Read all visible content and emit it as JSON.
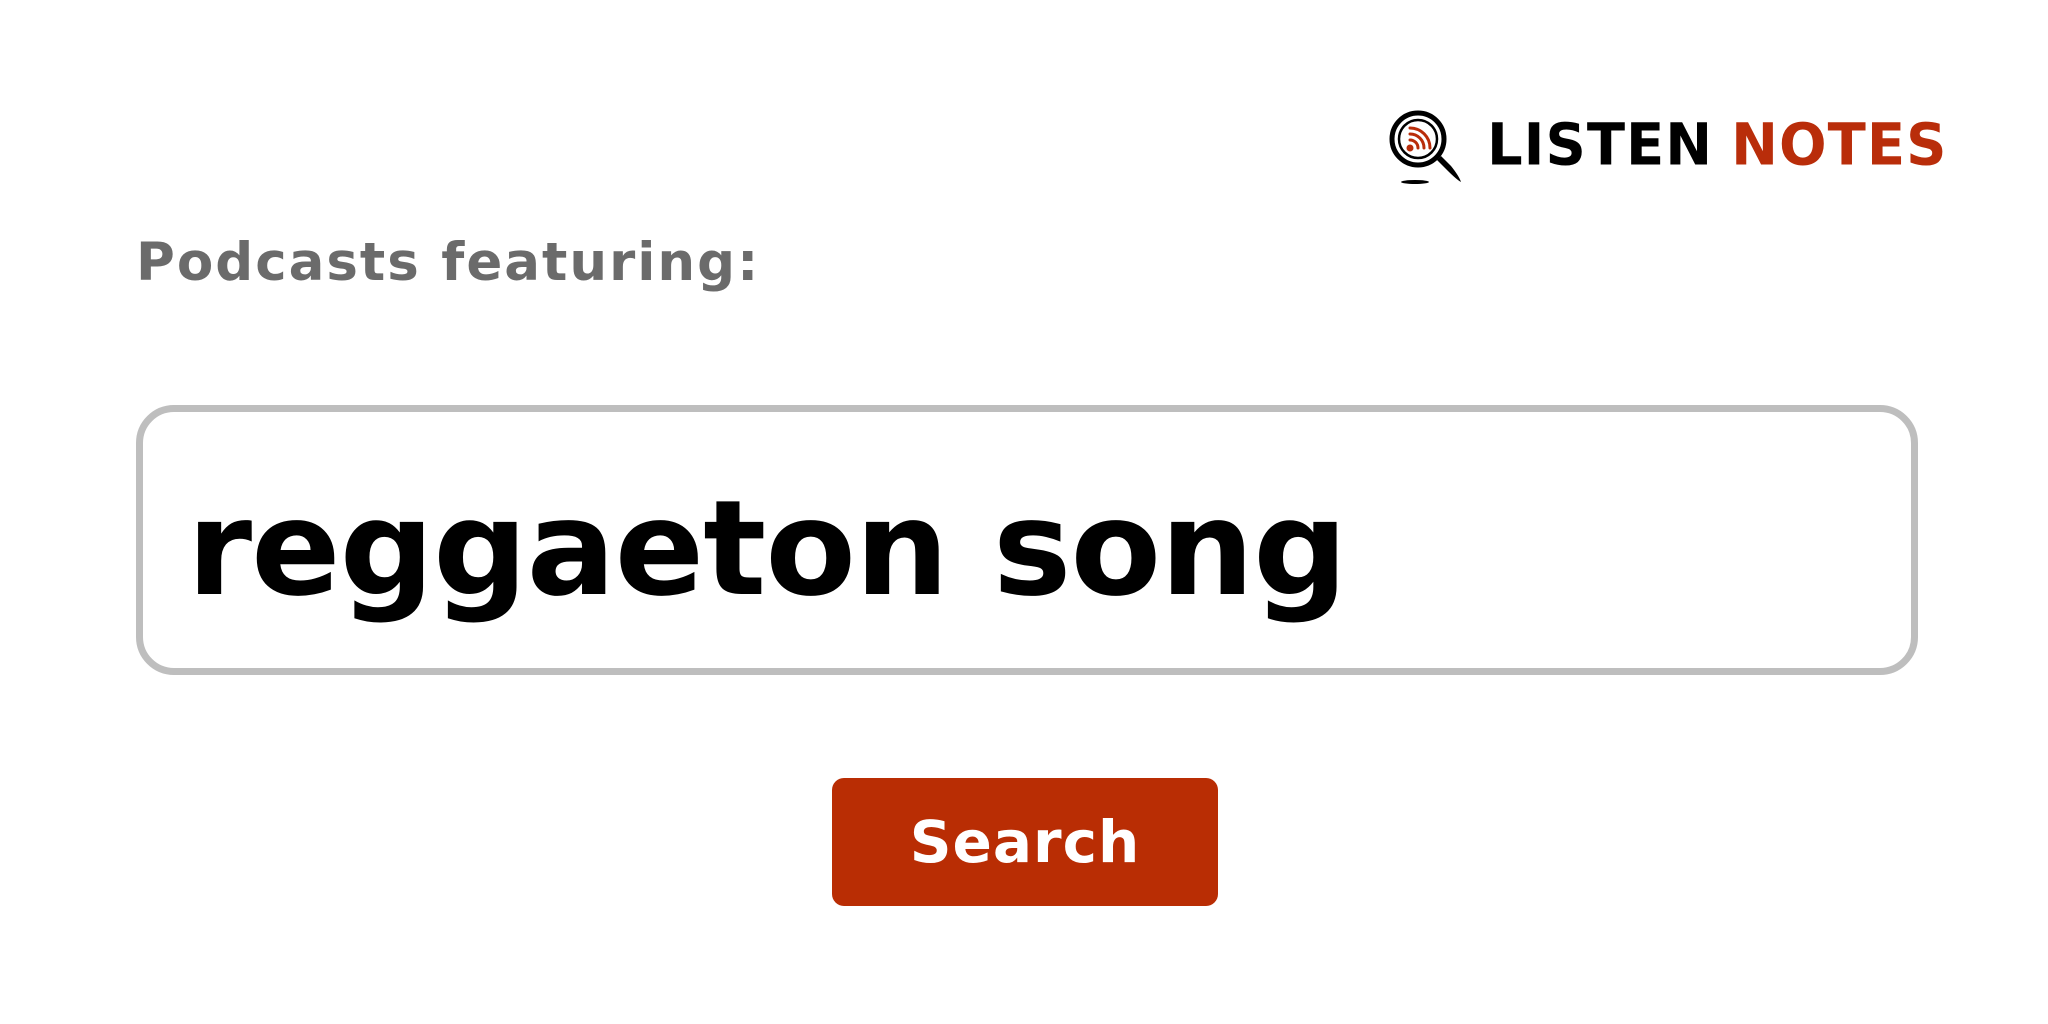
{
  "brand": {
    "word_1": "LISTEN",
    "word_2": "NOTES",
    "icon": "magnifier-podcast-icon",
    "colors": {
      "primary": "#000000",
      "accent": "#b92d0a"
    }
  },
  "header": {
    "label": "Podcasts featuring:"
  },
  "search": {
    "value": "reggaeton song",
    "button_label": "Search",
    "button_color": "#b92d04",
    "border_color": "#bebebe"
  }
}
